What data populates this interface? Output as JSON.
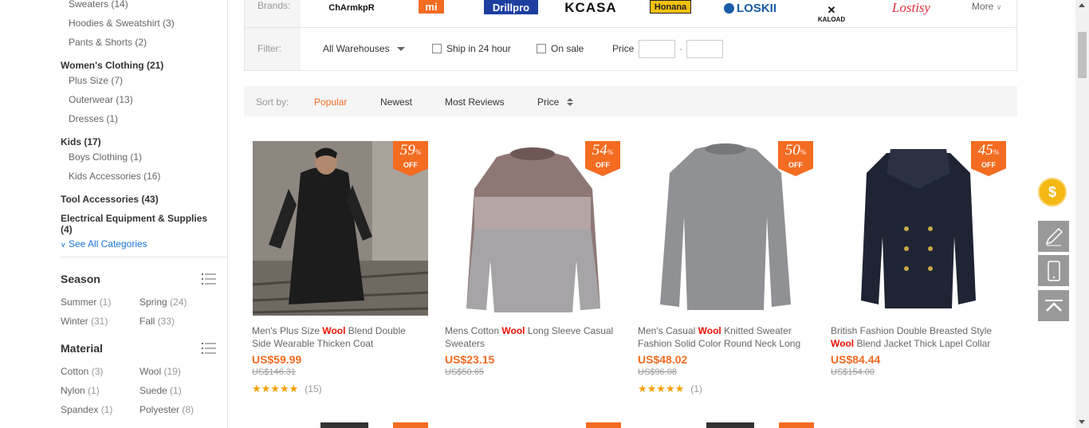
{
  "sidebar": {
    "categories": [
      {
        "label": "Sweaters (14)",
        "level": "sub"
      },
      {
        "label": "Hoodies & Sweatshirt (3)",
        "level": "sub"
      },
      {
        "label": "Pants & Shorts (2)",
        "level": "sub"
      },
      {
        "label": "Women's Clothing (21)",
        "level": "main"
      },
      {
        "label": "Plus Size (7)",
        "level": "sub"
      },
      {
        "label": "Outerwear (13)",
        "level": "sub"
      },
      {
        "label": "Dresses (1)",
        "level": "sub"
      },
      {
        "label": "Kids (17)",
        "level": "main"
      },
      {
        "label": "Boys Clothing (1)",
        "level": "sub"
      },
      {
        "label": "Kids Accessories (16)",
        "level": "sub"
      },
      {
        "label": "Tool Accessories (43)",
        "level": "main"
      },
      {
        "label": "Electrical Equipment & Supplies",
        "level": "main"
      },
      {
        "label": "(4)",
        "level": "main"
      }
    ],
    "see_all": "See All Categories",
    "season": {
      "title": "Season",
      "items": [
        {
          "name": "Summer",
          "count": "(1)"
        },
        {
          "name": "Spring",
          "count": "(24)"
        },
        {
          "name": "Winter",
          "count": "(31)"
        },
        {
          "name": "Fall",
          "count": "(33)"
        }
      ]
    },
    "material": {
      "title": "Material",
      "items": [
        {
          "name": "Cotton",
          "count": "(3)"
        },
        {
          "name": "Wool",
          "count": "(19)"
        },
        {
          "name": "Nylon",
          "count": "(1)"
        },
        {
          "name": "Suede",
          "count": "(1)"
        },
        {
          "name": "Spandex",
          "count": "(1)"
        },
        {
          "name": "Polyester",
          "count": "(8)"
        }
      ]
    }
  },
  "brands": {
    "label": "Brands:",
    "logos": [
      "ChArmkpR",
      "mi",
      "Drillpro",
      "KCASA",
      "Honana",
      "LOSKII",
      "KALOAD",
      "Lostisy"
    ],
    "more": "More"
  },
  "filter": {
    "label": "Filter:",
    "warehouse": "All Warehouses",
    "ship24": "Ship in 24 hour",
    "onsale": "On sale",
    "price_label": "Price",
    "dash": "-"
  },
  "sort": {
    "label": "Sort by:",
    "options": [
      "Popular",
      "Newest",
      "Most Reviews",
      "Price"
    ],
    "active": "Popular"
  },
  "products": [
    {
      "discount": "59",
      "title_pre": "Men's Plus Size ",
      "title_hl": "Wool",
      "title_post": " Blend Double Side Wearable Thicken Coat",
      "price": "US$59.99",
      "old_price": "US$146.31",
      "reviews": "(15)",
      "has_rating": true
    },
    {
      "discount": "54",
      "title_pre": "Mens Cotton ",
      "title_hl": "Wool",
      "title_post": " Long Sleeve Casual Sweaters",
      "price": "US$23.15",
      "old_price": "US$50.65",
      "reviews": "",
      "has_rating": false
    },
    {
      "discount": "50",
      "title_pre": "Men's Casual ",
      "title_hl": "Wool",
      "title_post": " Knitted Sweater Fashion Solid Color Round Neck Long",
      "price": "US$48.02",
      "old_price": "US$96.08",
      "reviews": "(1)",
      "has_rating": true
    },
    {
      "discount": "45",
      "title_pre": "British Fashion Double Breasted Style ",
      "title_hl": "Wool",
      "title_post": " Blend Jacket Thick Lapel Collar",
      "price": "US$84.44",
      "old_price": "US$154.00",
      "reviews": "",
      "has_rating": false
    }
  ],
  "badge_off": "OFF",
  "badge_pct": "%",
  "stars": "★★★★★",
  "colors": {
    "accent": "#f36c21",
    "highlight": "#e10000",
    "link": "#1a73d9"
  }
}
